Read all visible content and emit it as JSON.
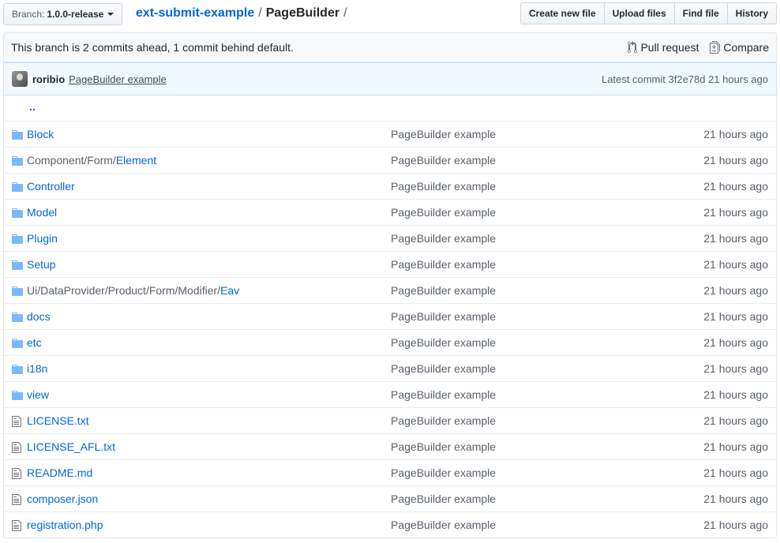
{
  "branch": {
    "prefix": "Branch:",
    "name": "1.0.0-release"
  },
  "breadcrumb": {
    "repo": "ext-submit-example",
    "sep1": "/",
    "current": "PageBuilder",
    "sep2": "/"
  },
  "file_actions": {
    "create": "Create new file",
    "upload": "Upload files",
    "find": "Find file",
    "history": "History"
  },
  "branch_info": {
    "message": "This branch is 2 commits ahead, 1 commit behind default.",
    "pull_request": "Pull request",
    "compare": "Compare"
  },
  "latest_commit": {
    "author": "roribio",
    "message": "PageBuilder example",
    "label": "Latest commit 3f2e78d 21 hours ago"
  },
  "up_dir": "..",
  "files": [
    {
      "type": "dir",
      "prefix": "",
      "link": "Block",
      "message": "PageBuilder example",
      "age": "21 hours ago"
    },
    {
      "type": "dir",
      "prefix": "Component/Form/",
      "link": "Element",
      "message": "PageBuilder example",
      "age": "21 hours ago"
    },
    {
      "type": "dir",
      "prefix": "",
      "link": "Controller",
      "message": "PageBuilder example",
      "age": "21 hours ago"
    },
    {
      "type": "dir",
      "prefix": "",
      "link": "Model",
      "message": "PageBuilder example",
      "age": "21 hours ago"
    },
    {
      "type": "dir",
      "prefix": "",
      "link": "Plugin",
      "message": "PageBuilder example",
      "age": "21 hours ago"
    },
    {
      "type": "dir",
      "prefix": "",
      "link": "Setup",
      "message": "PageBuilder example",
      "age": "21 hours ago"
    },
    {
      "type": "dir",
      "prefix": "Ui/DataProvider/Product/Form/Modifier/",
      "link": "Eav",
      "message": "PageBuilder example",
      "age": "21 hours ago"
    },
    {
      "type": "dir",
      "prefix": "",
      "link": "docs",
      "message": "PageBuilder example",
      "age": "21 hours ago"
    },
    {
      "type": "dir",
      "prefix": "",
      "link": "etc",
      "message": "PageBuilder example",
      "age": "21 hours ago"
    },
    {
      "type": "dir",
      "prefix": "",
      "link": "i18n",
      "message": "PageBuilder example",
      "age": "21 hours ago"
    },
    {
      "type": "dir",
      "prefix": "",
      "link": "view",
      "message": "PageBuilder example",
      "age": "21 hours ago"
    },
    {
      "type": "file",
      "prefix": "",
      "link": "LICENSE.txt",
      "message": "PageBuilder example",
      "age": "21 hours ago"
    },
    {
      "type": "file",
      "prefix": "",
      "link": "LICENSE_AFL.txt",
      "message": "PageBuilder example",
      "age": "21 hours ago"
    },
    {
      "type": "file",
      "prefix": "",
      "link": "README.md",
      "message": "PageBuilder example",
      "age": "21 hours ago"
    },
    {
      "type": "file",
      "prefix": "",
      "link": "composer.json",
      "message": "PageBuilder example",
      "age": "21 hours ago"
    },
    {
      "type": "file",
      "prefix": "",
      "link": "registration.php",
      "message": "PageBuilder example",
      "age": "21 hours ago"
    }
  ],
  "colors": {
    "link": "#0366d6",
    "folder_icon": "#79b8ff",
    "file_icon": "#6a737d",
    "commit_bg": "#f1f8ff"
  }
}
